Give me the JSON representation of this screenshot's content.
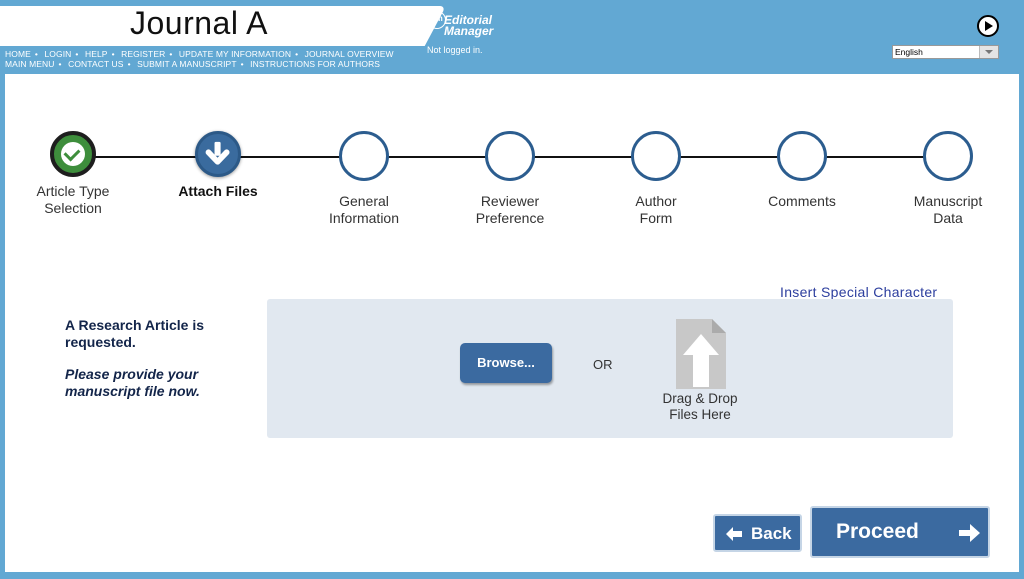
{
  "header": {
    "journal_title": "Journal A",
    "nav_row1": [
      "HOME",
      "LOGIN",
      "HELP",
      "REGISTER",
      "UPDATE MY INFORMATION",
      "JOURNAL OVERVIEW"
    ],
    "nav_row2": [
      "MAIN MENU",
      "CONTACT US",
      "SUBMIT A MANUSCRIPT",
      "INSTRUCTIONS FOR AUTHORS"
    ],
    "logo_mark": "em",
    "logo_line1": "Editorial",
    "logo_line2": "Manager",
    "login_status": "Not logged in.",
    "language": "English"
  },
  "steps": [
    {
      "label1": "Article Type",
      "label2": "Selection",
      "state": "done"
    },
    {
      "label1": "Attach Files",
      "label2": "",
      "state": "current"
    },
    {
      "label1": "General",
      "label2": "Information",
      "state": "pending"
    },
    {
      "label1": "Reviewer",
      "label2": "Preference",
      "state": "pending"
    },
    {
      "label1": "Author",
      "label2": "Form",
      "state": "pending"
    },
    {
      "label1": "Comments",
      "label2": "",
      "state": "pending"
    },
    {
      "label1": "Manuscript",
      "label2": "Data",
      "state": "pending"
    }
  ],
  "upload": {
    "special_char_link": "Insert Special Character",
    "request_line1": "A Research Article is",
    "request_line2": "requested.",
    "prompt_line1": "Please provide your",
    "prompt_line2": "manuscript file now.",
    "browse_label": "Browse...",
    "or_label": "OR",
    "drop_line1": "Drag & Drop",
    "drop_line2": "Files Here"
  },
  "actions": {
    "back_label": "Back",
    "proceed_label": "Proceed"
  },
  "colors": {
    "header_bg": "#62a8d3",
    "button_bg": "#3b6aa0",
    "done_green": "#3e8e3c",
    "upload_bg": "#e1e8f0"
  }
}
